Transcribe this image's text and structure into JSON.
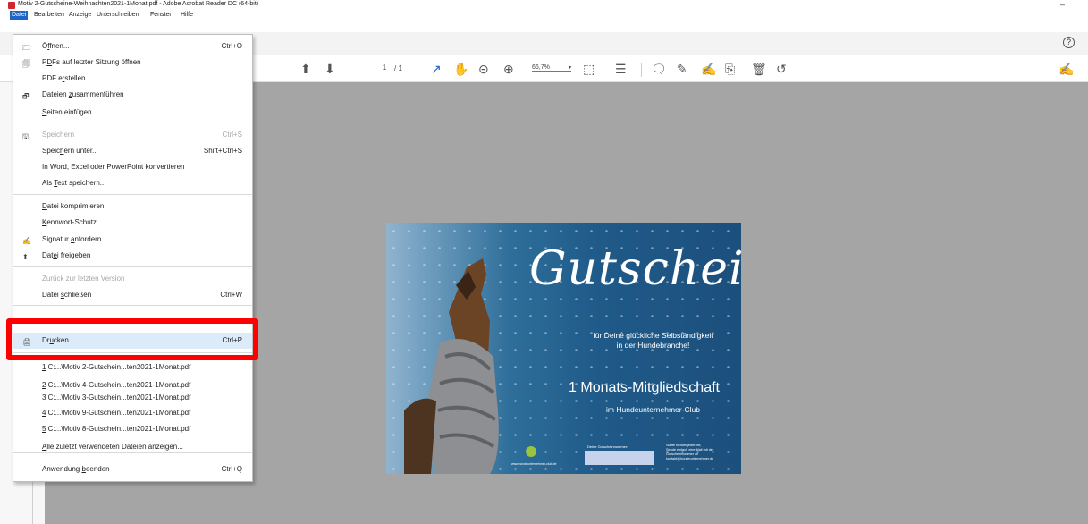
{
  "window": {
    "title": "Motiv 2-Gutscheine-Weihnachten2021-1Monat.pdf - Adobe Acrobat Reader DC (64-bit)",
    "minimize_glyph": "–"
  },
  "menubar": {
    "items": [
      "Datei",
      "Bearbeiten",
      "Anzeige",
      "Unterschreiben",
      "Fenster",
      "Hilfe"
    ]
  },
  "tabrow": {
    "help_glyph": "?"
  },
  "toolbar": {
    "page_current": "1",
    "page_total": "/ 1",
    "zoom": "66,7%"
  },
  "menu": {
    "items": [
      {
        "pre": "Ö",
        "u": "f",
        "post": "fnen...",
        "shortcut": "Ctrl+O",
        "icon": "folder-open-icon"
      },
      {
        "pre": "P",
        "u": "D",
        "post": "Fs auf letzter Sitzung öffnen",
        "shortcut": "",
        "icon": "recent-pdfs-icon"
      },
      {
        "pre": "PDF e",
        "u": "r",
        "post": "stellen",
        "shortcut": "",
        "icon": ""
      },
      {
        "pre": "Dateien ",
        "u": "z",
        "post": "usammenführen",
        "shortcut": "",
        "icon": "combine-files-icon"
      },
      {
        "pre": "",
        "u": "S",
        "post": "eiten einfügen",
        "shortcut": "",
        "icon": ""
      },
      {
        "pre": "Speichern",
        "u": "",
        "post": "",
        "shortcut": "Ctrl+S",
        "icon": "save-icon",
        "disabled": true
      },
      {
        "pre": "Speic",
        "u": "h",
        "post": "ern unter...",
        "shortcut": "Shift+Ctrl+S",
        "icon": ""
      },
      {
        "pre": "In Word, Excel oder PowerPoint konvertieren",
        "u": "",
        "post": "",
        "shortcut": "",
        "icon": ""
      },
      {
        "pre": "Als ",
        "u": "T",
        "post": "ext speichern...",
        "shortcut": "",
        "icon": ""
      },
      {
        "pre": "",
        "u": "D",
        "post": "atei komprimieren",
        "shortcut": "",
        "icon": ""
      },
      {
        "pre": "",
        "u": "K",
        "post": "ennwort-Schutz",
        "shortcut": "",
        "icon": ""
      },
      {
        "pre": "Signatur ",
        "u": "a",
        "post": "nfordern",
        "shortcut": "",
        "icon": "request-signature-icon"
      },
      {
        "pre": "Dat",
        "u": "e",
        "post": "i freigeben",
        "shortcut": "",
        "icon": "share-file-icon"
      },
      {
        "pre": "Zurück zur letzten Version",
        "u": "",
        "post": "",
        "shortcut": "",
        "icon": "",
        "disabled": true
      },
      {
        "pre": "Datei ",
        "u": "s",
        "post": "chließen",
        "shortcut": "Ctrl+W",
        "icon": ""
      },
      {
        "pre": "Dr",
        "u": "u",
        "post": "cken...",
        "shortcut": "Ctrl+P",
        "icon": "printer-icon"
      },
      {
        "pre": "",
        "u": "1",
        "post": " C:...\\Motiv 2-Gutschein...ten2021-1Monat.pdf",
        "shortcut": "",
        "icon": ""
      },
      {
        "pre": "",
        "u": "2",
        "post": " C:...\\Motiv 4-Gutschein...ten2021-1Monat.pdf",
        "shortcut": "",
        "icon": ""
      },
      {
        "pre": "",
        "u": "3",
        "post": " C:...\\Motiv 3-Gutschein...ten2021-1Monat.pdf",
        "shortcut": "",
        "icon": ""
      },
      {
        "pre": "",
        "u": "4",
        "post": " C:...\\Motiv 9-Gutschein...ten2021-1Monat.pdf",
        "shortcut": "",
        "icon": ""
      },
      {
        "pre": "",
        "u": "5",
        "post": " C:...\\Motiv 8-Gutschein...ten2021-1Monat.pdf",
        "shortcut": "",
        "icon": ""
      },
      {
        "pre": "",
        "u": "A",
        "post": "lle zuletzt verwendeten Dateien anzeigen...",
        "shortcut": "",
        "icon": ""
      },
      {
        "pre": "Anwendung ",
        "u": "b",
        "post": "eenden",
        "shortcut": "Ctrl+Q",
        "icon": ""
      }
    ]
  },
  "voucher": {
    "title": "Gutschein",
    "subtitle_line1": "für Deine glückliche Selbständigkeit",
    "subtitle_line2": "in der Hundebranche!",
    "headline": "1 Monats-Mitgliedschaft",
    "club": "im Hundeunternehmer-Club",
    "code_label": "Deine Gutscheinnummer:",
    "hint_line1": "Starte flexibel jederzeit,",
    "hint_line2": "Sende einfach eine Mail mit der",
    "hint_line3": "Gutscheinnummer an",
    "hint_line4": "kontakt@hundeunternehmer.de",
    "url": "www.hundeunternehmer-club.de"
  }
}
